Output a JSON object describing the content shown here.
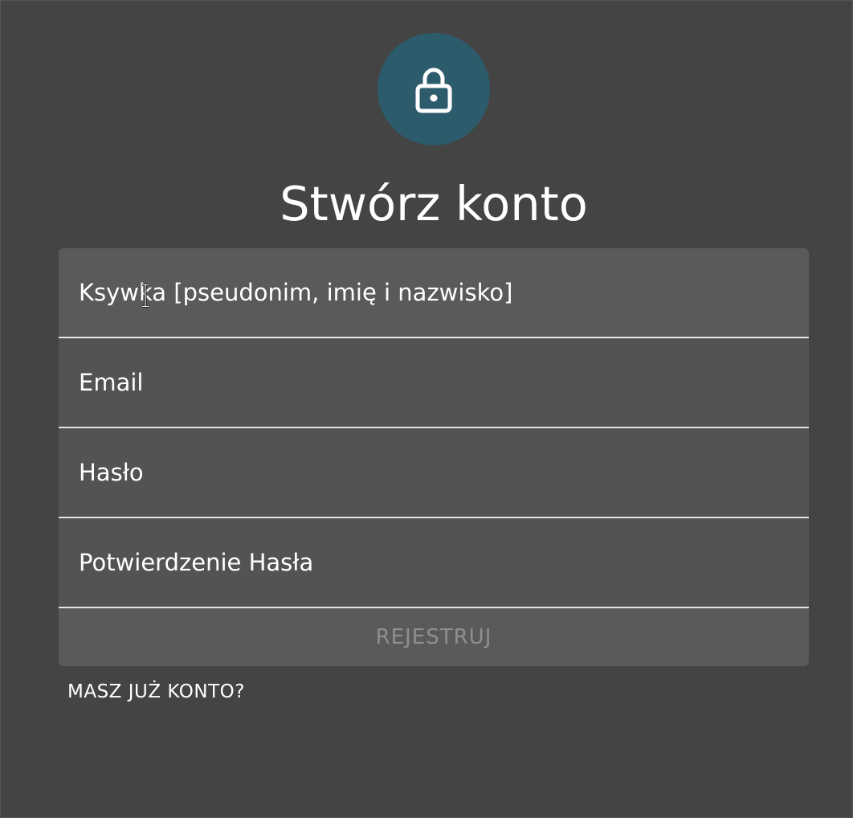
{
  "header": {
    "icon": "lock-icon",
    "title": "Stwórz konto"
  },
  "form": {
    "fields": [
      {
        "placeholder": "Ksywka [pseudonim, imię i nazwisko]",
        "value": ""
      },
      {
        "placeholder": "Email",
        "value": ""
      },
      {
        "placeholder": "Hasło",
        "value": ""
      },
      {
        "placeholder": "Potwierdzenie Hasła",
        "value": ""
      }
    ],
    "submit_label": "REJESTRUJ"
  },
  "footer": {
    "login_link": "MASZ JUŻ KONTO?"
  },
  "colors": {
    "background": "#444444",
    "accent": "#2c5b6c",
    "field": "#535353",
    "disabled_text": "#8f8f8f"
  }
}
